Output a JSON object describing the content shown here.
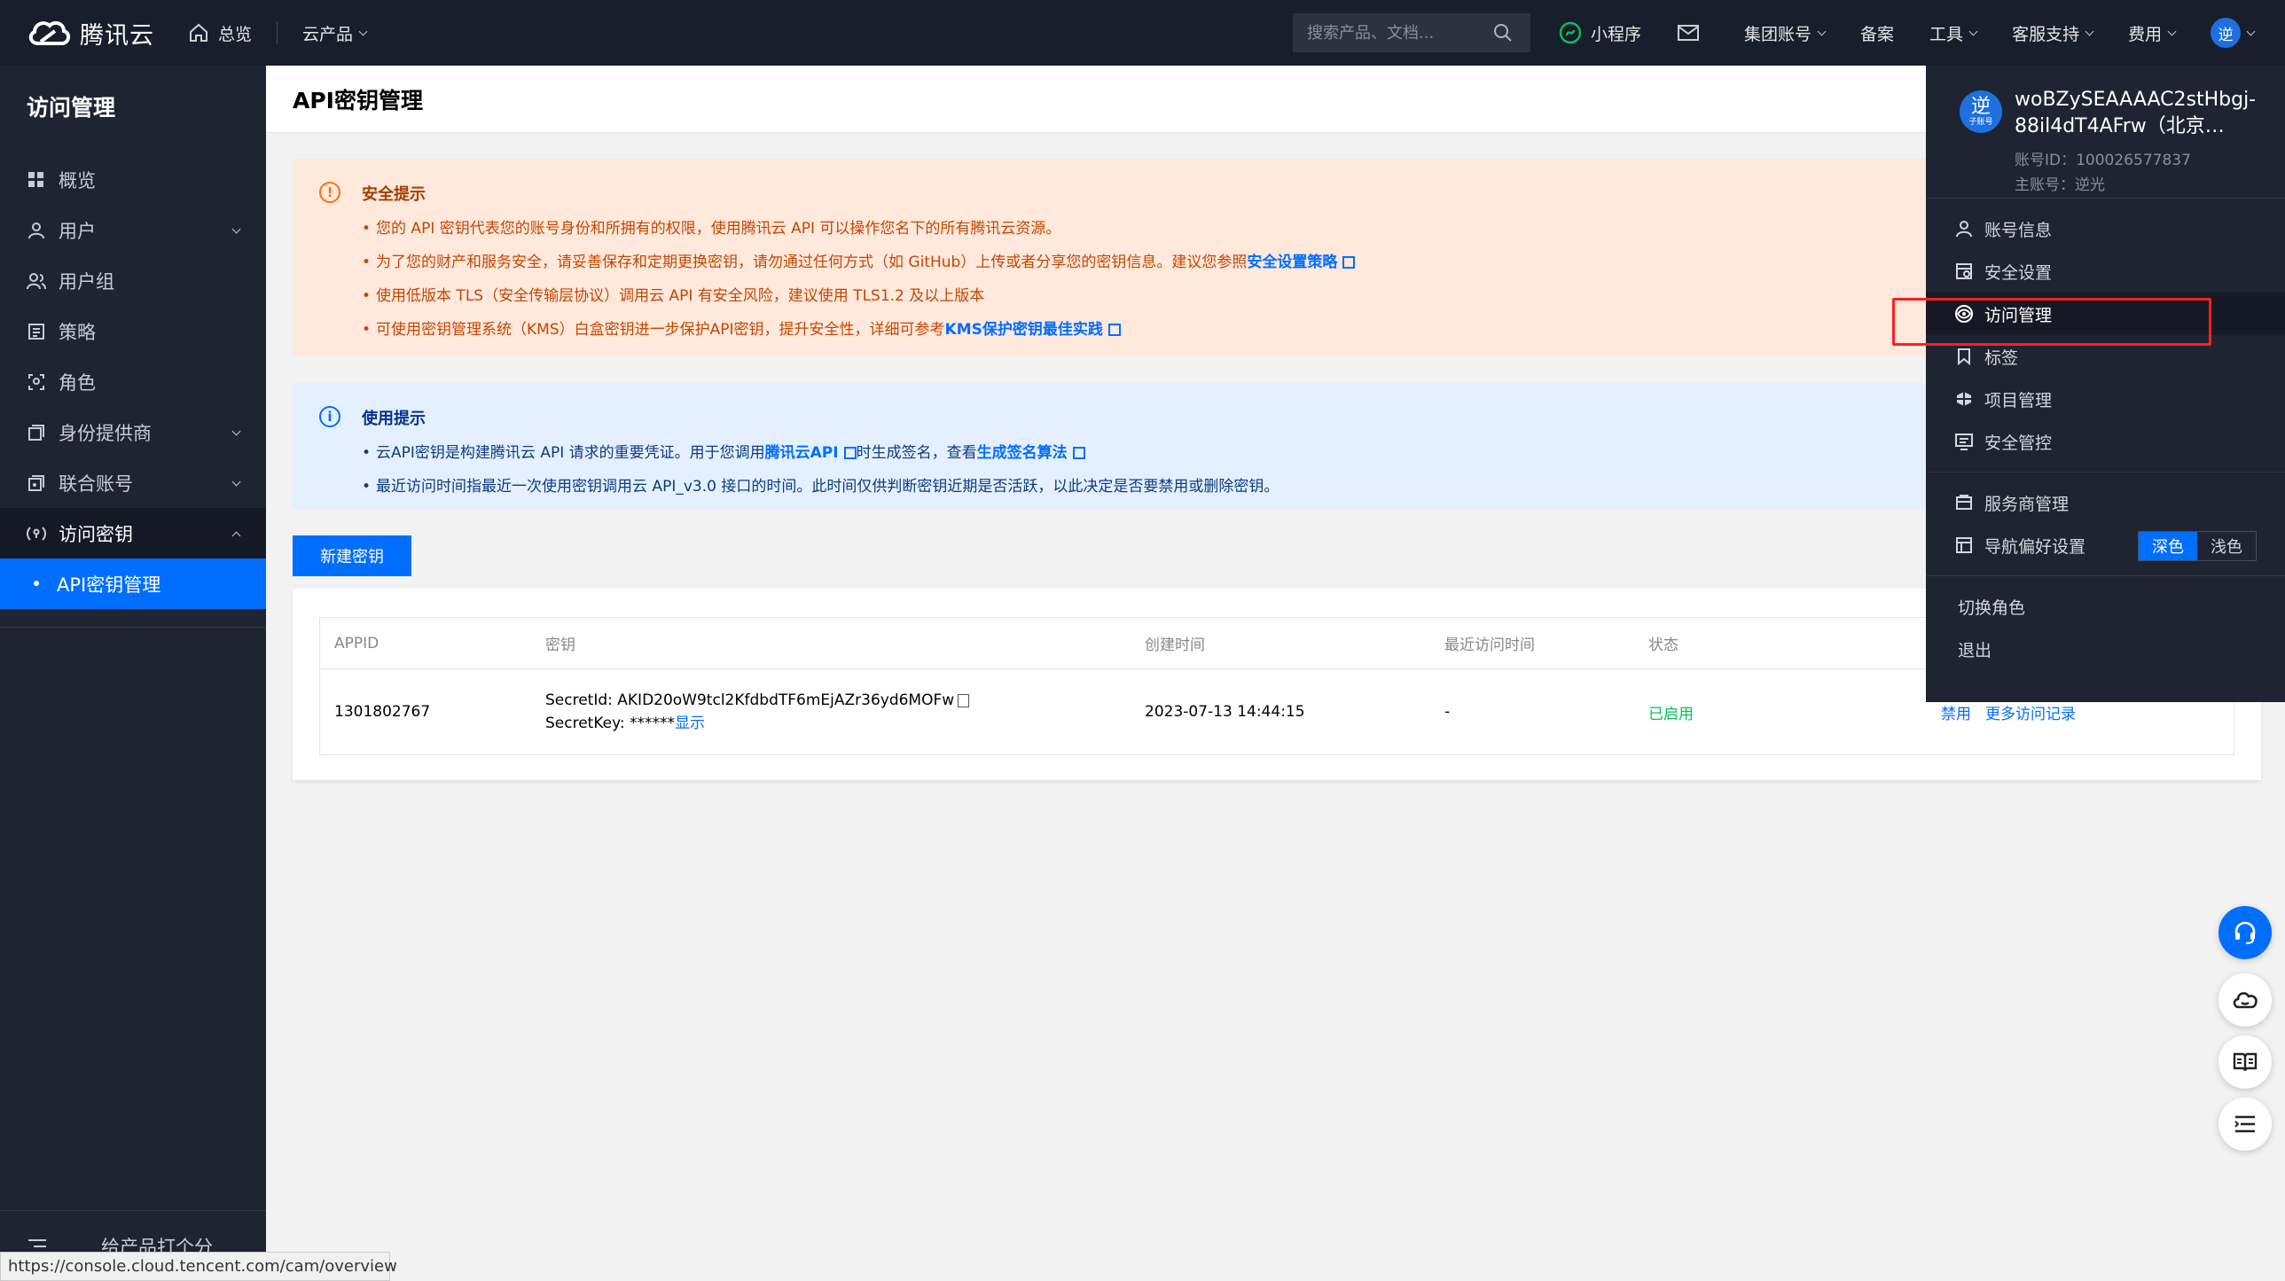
{
  "topbar": {
    "brand": "腾讯云",
    "overview": "总览",
    "products": "云产品",
    "search_placeholder": "搜索产品、文档...",
    "mini_program": "小程序",
    "group_account": "集团账号",
    "filing": "备案",
    "tools": "工具",
    "support": "客服支持",
    "billing": "费用",
    "avatar_char": "逆"
  },
  "sidebar": {
    "title": "访问管理",
    "items": [
      {
        "label": "概览"
      },
      {
        "label": "用户"
      },
      {
        "label": "用户组"
      },
      {
        "label": "策略"
      },
      {
        "label": "角色"
      },
      {
        "label": "身份提供商"
      },
      {
        "label": "联合账号"
      },
      {
        "label": "访问密钥"
      }
    ],
    "sub_item": "API密钥管理",
    "bottom": "给产品打个分"
  },
  "page": {
    "title": "API密钥管理",
    "security_notice": {
      "title": "安全提示",
      "line1": "您的 API 密钥代表您的账号身份和所拥有的权限，使用腾讯云 API 可以操作您名下的所有腾讯云资源。",
      "line2_pre": "为了您的财产和服务安全，请妥善保存和定期更换密钥，请勿通过任何方式（如 GitHub）上传或者分享您的密钥信息。建议您参照",
      "line2_link": "安全设置策略",
      "line3": "使用低版本 TLS（安全传输层协议）调用云 API 有安全风险，建议使用 TLS1.2 及以上版本",
      "line4_pre": "可使用密钥管理系统（KMS）白盒密钥进一步保护API密钥，提升安全性，详细可参考",
      "line4_link": "KMS保护密钥最佳实践"
    },
    "usage_notice": {
      "title": "使用提示",
      "line1_pre": "云API密钥是构建腾讯云 API 请求的重要凭证。用于您调用",
      "line1_link1": "腾讯云API",
      "line1_mid": "时生成签名，查看",
      "line1_link2": "生成签名算法",
      "line2": "最近访问时间指最近一次使用密钥调用云 API_v3.0 接口的时间。此时间仅供判断密钥近期是否活跃，以此决定是否要禁用或删除密钥。"
    },
    "new_key_button": "新建密钥",
    "table": {
      "headers": {
        "appid": "APPID",
        "key": "密钥",
        "created": "创建时间",
        "last_access": "最近访问时间",
        "status": "状态"
      },
      "rows": [
        {
          "appid": "1301802767",
          "secret_id": "SecretId: AKID20oW9tcl2KfdbdTF6mEjAZr36yd6MOFw",
          "secret_key": "SecretKey: ******",
          "show": "显示",
          "created": "2023-07-13 14:44:15",
          "last_access": "-",
          "status": "已启用",
          "op_disable": "禁用",
          "op_more": "更多访问记录"
        }
      ]
    }
  },
  "account_menu": {
    "avatar_char": "逆",
    "avatar_tag": "子账号",
    "name": "woBZySEAAAAC2stHbgj-88il4dT4AFrw（北京…",
    "account_id": "账号ID：100026577837",
    "main_account": "主账号：逆光",
    "items": {
      "account_info": "账号信息",
      "security_settings": "安全设置",
      "access_management": "访问管理",
      "tags": "标签",
      "projects": "项目管理",
      "security_control": "安全管控",
      "provider_management": "服务商管理",
      "nav_preferences": "导航偏好设置"
    },
    "theme_dark": "深色",
    "theme_light": "浅色",
    "switch_role": "切换角色",
    "logout": "退出"
  },
  "status_url": "https://console.cloud.tencent.com/cam/overview",
  "colors": {
    "accent": "#006eff",
    "success": "#0abf5b",
    "warning": "#ff7200",
    "highlight": "#ff2020"
  }
}
